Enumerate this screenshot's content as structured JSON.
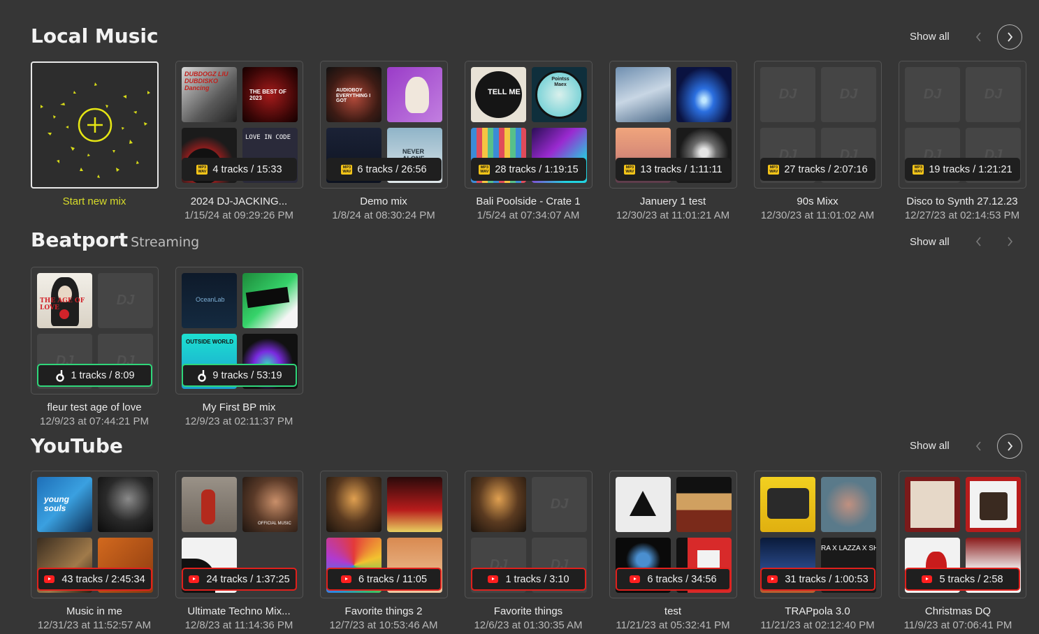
{
  "local": {
    "title": "Local Music",
    "show_all": "Show all",
    "new_mix_label": "Start new mix",
    "cards": [
      {
        "badge": "4 tracks / 15:33",
        "name": "2024 DJ-JACKING...",
        "date": "1/15/24 at 09:29:26 PM"
      },
      {
        "badge": "6 tracks / 26:56",
        "name": "Demo mix",
        "date": "1/8/24 at 08:30:24 PM"
      },
      {
        "badge": "28 tracks / 1:19:15",
        "name": "Bali Poolside - Crate 1",
        "date": "1/5/24 at 07:34:07 AM"
      },
      {
        "badge": "13 tracks / 1:11:11",
        "name": "Januery 1 test",
        "date": "12/30/23 at 11:01:21 AM"
      },
      {
        "badge": "27 tracks / 2:07:16",
        "name": "90s Mixx",
        "date": "12/30/23 at 11:01:02 AM"
      },
      {
        "badge": "19 tracks / 1:21:21",
        "name": "Disco to Synth 27.12.23",
        "date": "12/27/23 at 02:14:53 PM"
      }
    ],
    "art_text": {
      "c0_t0": "DUBDOGZ LIU DUBDISKO Dancing",
      "c0_t1": "THE BEST OF 2023",
      "c0_t3": "LOVE IN CODE",
      "c1_t0": "AUDIOBOY EVERYTHING I GOT",
      "c1_t3": "NEVER ALONE",
      "c2_t0": "TELL ME",
      "c2_t1": "Pointss Maex"
    }
  },
  "beatport": {
    "title": "Beatport",
    "subtitle": "Streaming",
    "show_all": "Show all",
    "cards": [
      {
        "badge": "1 tracks / 8:09",
        "name": "fleur test age of love",
        "date": "12/9/23 at 07:44:21 PM"
      },
      {
        "badge": "9 tracks / 53:19",
        "name": "My First BP mix",
        "date": "12/9/23 at 02:11:37 PM"
      }
    ],
    "art_text": {
      "c0_t0": "THE AGE OF LOVE",
      "c1_t0": "OceanLab",
      "c1_t2": "OUTSIDE WORLD"
    }
  },
  "youtube": {
    "title": "YouTube",
    "show_all": "Show all",
    "cards": [
      {
        "badge": "43 tracks / 2:45:34",
        "name": "Music in me",
        "date": "12/31/23 at 11:52:57 AM"
      },
      {
        "badge": "24 tracks / 1:37:25",
        "name": "Ultimate Techno Mix...",
        "date": "12/8/23 at 11:14:36 PM"
      },
      {
        "badge": "6 tracks / 11:05",
        "name": "Favorite things 2",
        "date": "12/7/23 at 10:53:46 AM"
      },
      {
        "badge": "1 tracks / 3:10",
        "name": "Favorite things",
        "date": "12/6/23 at 01:30:35 AM"
      },
      {
        "badge": "6 tracks / 34:56",
        "name": "test",
        "date": "11/21/23 at 05:32:41 PM"
      },
      {
        "badge": "31 tracks / 1:00:53",
        "name": "TRAPpola 3.0",
        "date": "11/21/23 at 02:12:40 PM"
      },
      {
        "badge": "5 tracks / 2:58",
        "name": "Christmas DQ",
        "date": "11/9/23 at 07:06:41 PM"
      }
    ],
    "art_text": {
      "c0_t0": "young souls",
      "c1_t1": "OFFICIAL MUSIC",
      "c5_t3": "RA X LAZZA X SH"
    }
  },
  "placeholder_logo": "DJ",
  "mp3_label_top": "MP3",
  "mp3_label_bottom": "WAV",
  "colors": {
    "background": "#363636",
    "beatport_accent": "#2fd67a",
    "youtube_accent": "#e0201c",
    "new_mix_accent": "#e5e514",
    "mp3_badge": "#f5c518"
  }
}
